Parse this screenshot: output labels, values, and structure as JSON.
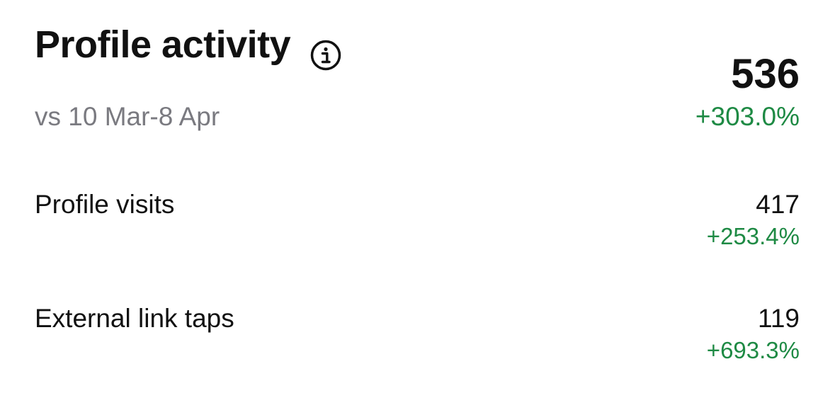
{
  "header": {
    "title": "Profile activity",
    "info_icon": "info-icon",
    "comparison_period": "vs 10 Mar-8 Apr"
  },
  "summary": {
    "total": "536",
    "change": "+303.0%"
  },
  "metrics": [
    {
      "label": "Profile visits",
      "value": "417",
      "change": "+253.4%"
    },
    {
      "label": "External link taps",
      "value": "119",
      "change": "+693.3%"
    }
  ],
  "colors": {
    "positive_change": "#1e8a44",
    "secondary_text": "#7a7a80",
    "primary_text": "#111111"
  }
}
